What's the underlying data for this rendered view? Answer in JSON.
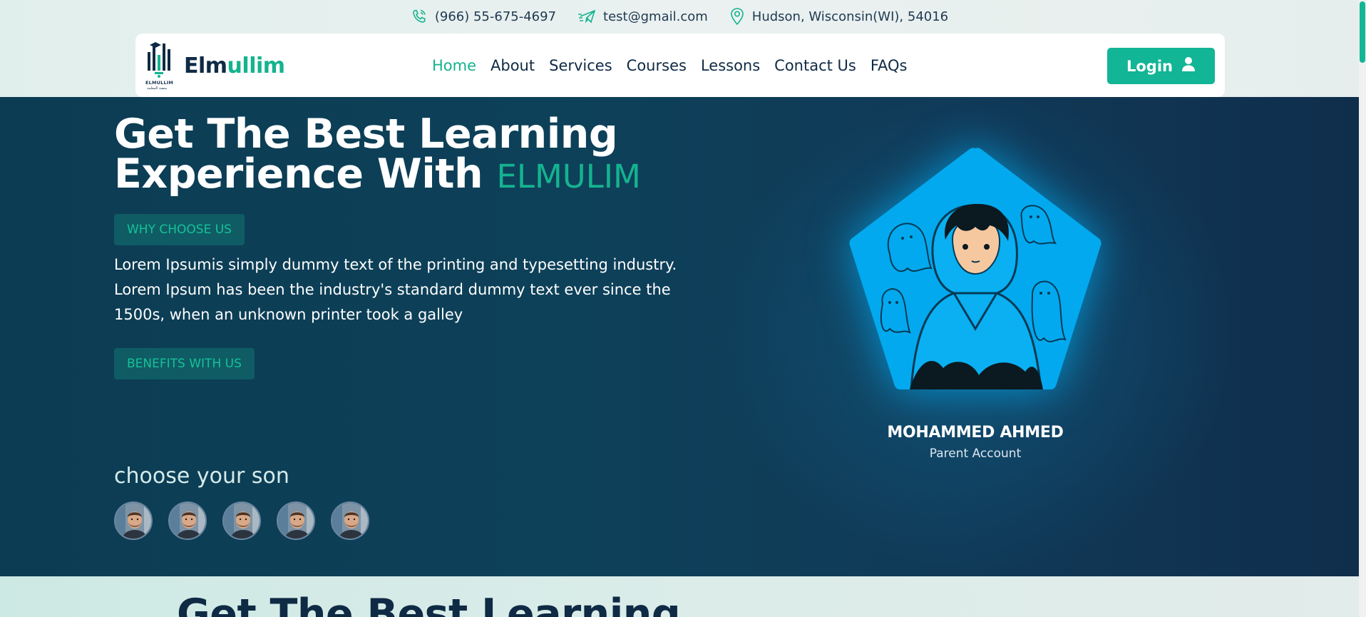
{
  "topbar": {
    "phone": "(966) 55-675-4697",
    "email": "test@gmail.com",
    "address": "Hudson, Wisconsin(WI), 54016",
    "icons": [
      "phone-icon",
      "email-send-icon",
      "location-pin-icon"
    ]
  },
  "navbar": {
    "logo_caption": "ELMULLIM",
    "logo_subcaption": "منصة المعلمة",
    "brand_part1": "Elm",
    "brand_part2": "ullim",
    "links": [
      "Home",
      "About",
      "Services",
      "Courses",
      "Lessons",
      "Contact Us",
      "FAQs"
    ],
    "active_link": "Home",
    "login_label": "Login"
  },
  "hero": {
    "title_line1": "Get The Best Learning",
    "title_line2": "Experience With",
    "title_accent": "ELMULIM",
    "why_label": "WHY CHOOSE US",
    "description": "Lorem Ipsumis simply dummy text of the printing and typesetting industry. Lorem Ipsum has been the industry's standard dummy text ever since the 1500s, when an unknown printer took a galley",
    "benefits_label": "BENEFITS WITH US",
    "choose_label": "choose your son",
    "children_count": 5
  },
  "profile": {
    "name": "MOHAMMED AHMED",
    "role": "Parent Account"
  },
  "next_section": {
    "title": "Get The Best Learning"
  },
  "colors": {
    "accent": "#14b38f",
    "navy": "#0f2a44",
    "hero_bg": "#0d4159",
    "profile_blue": "#00aaf0"
  }
}
